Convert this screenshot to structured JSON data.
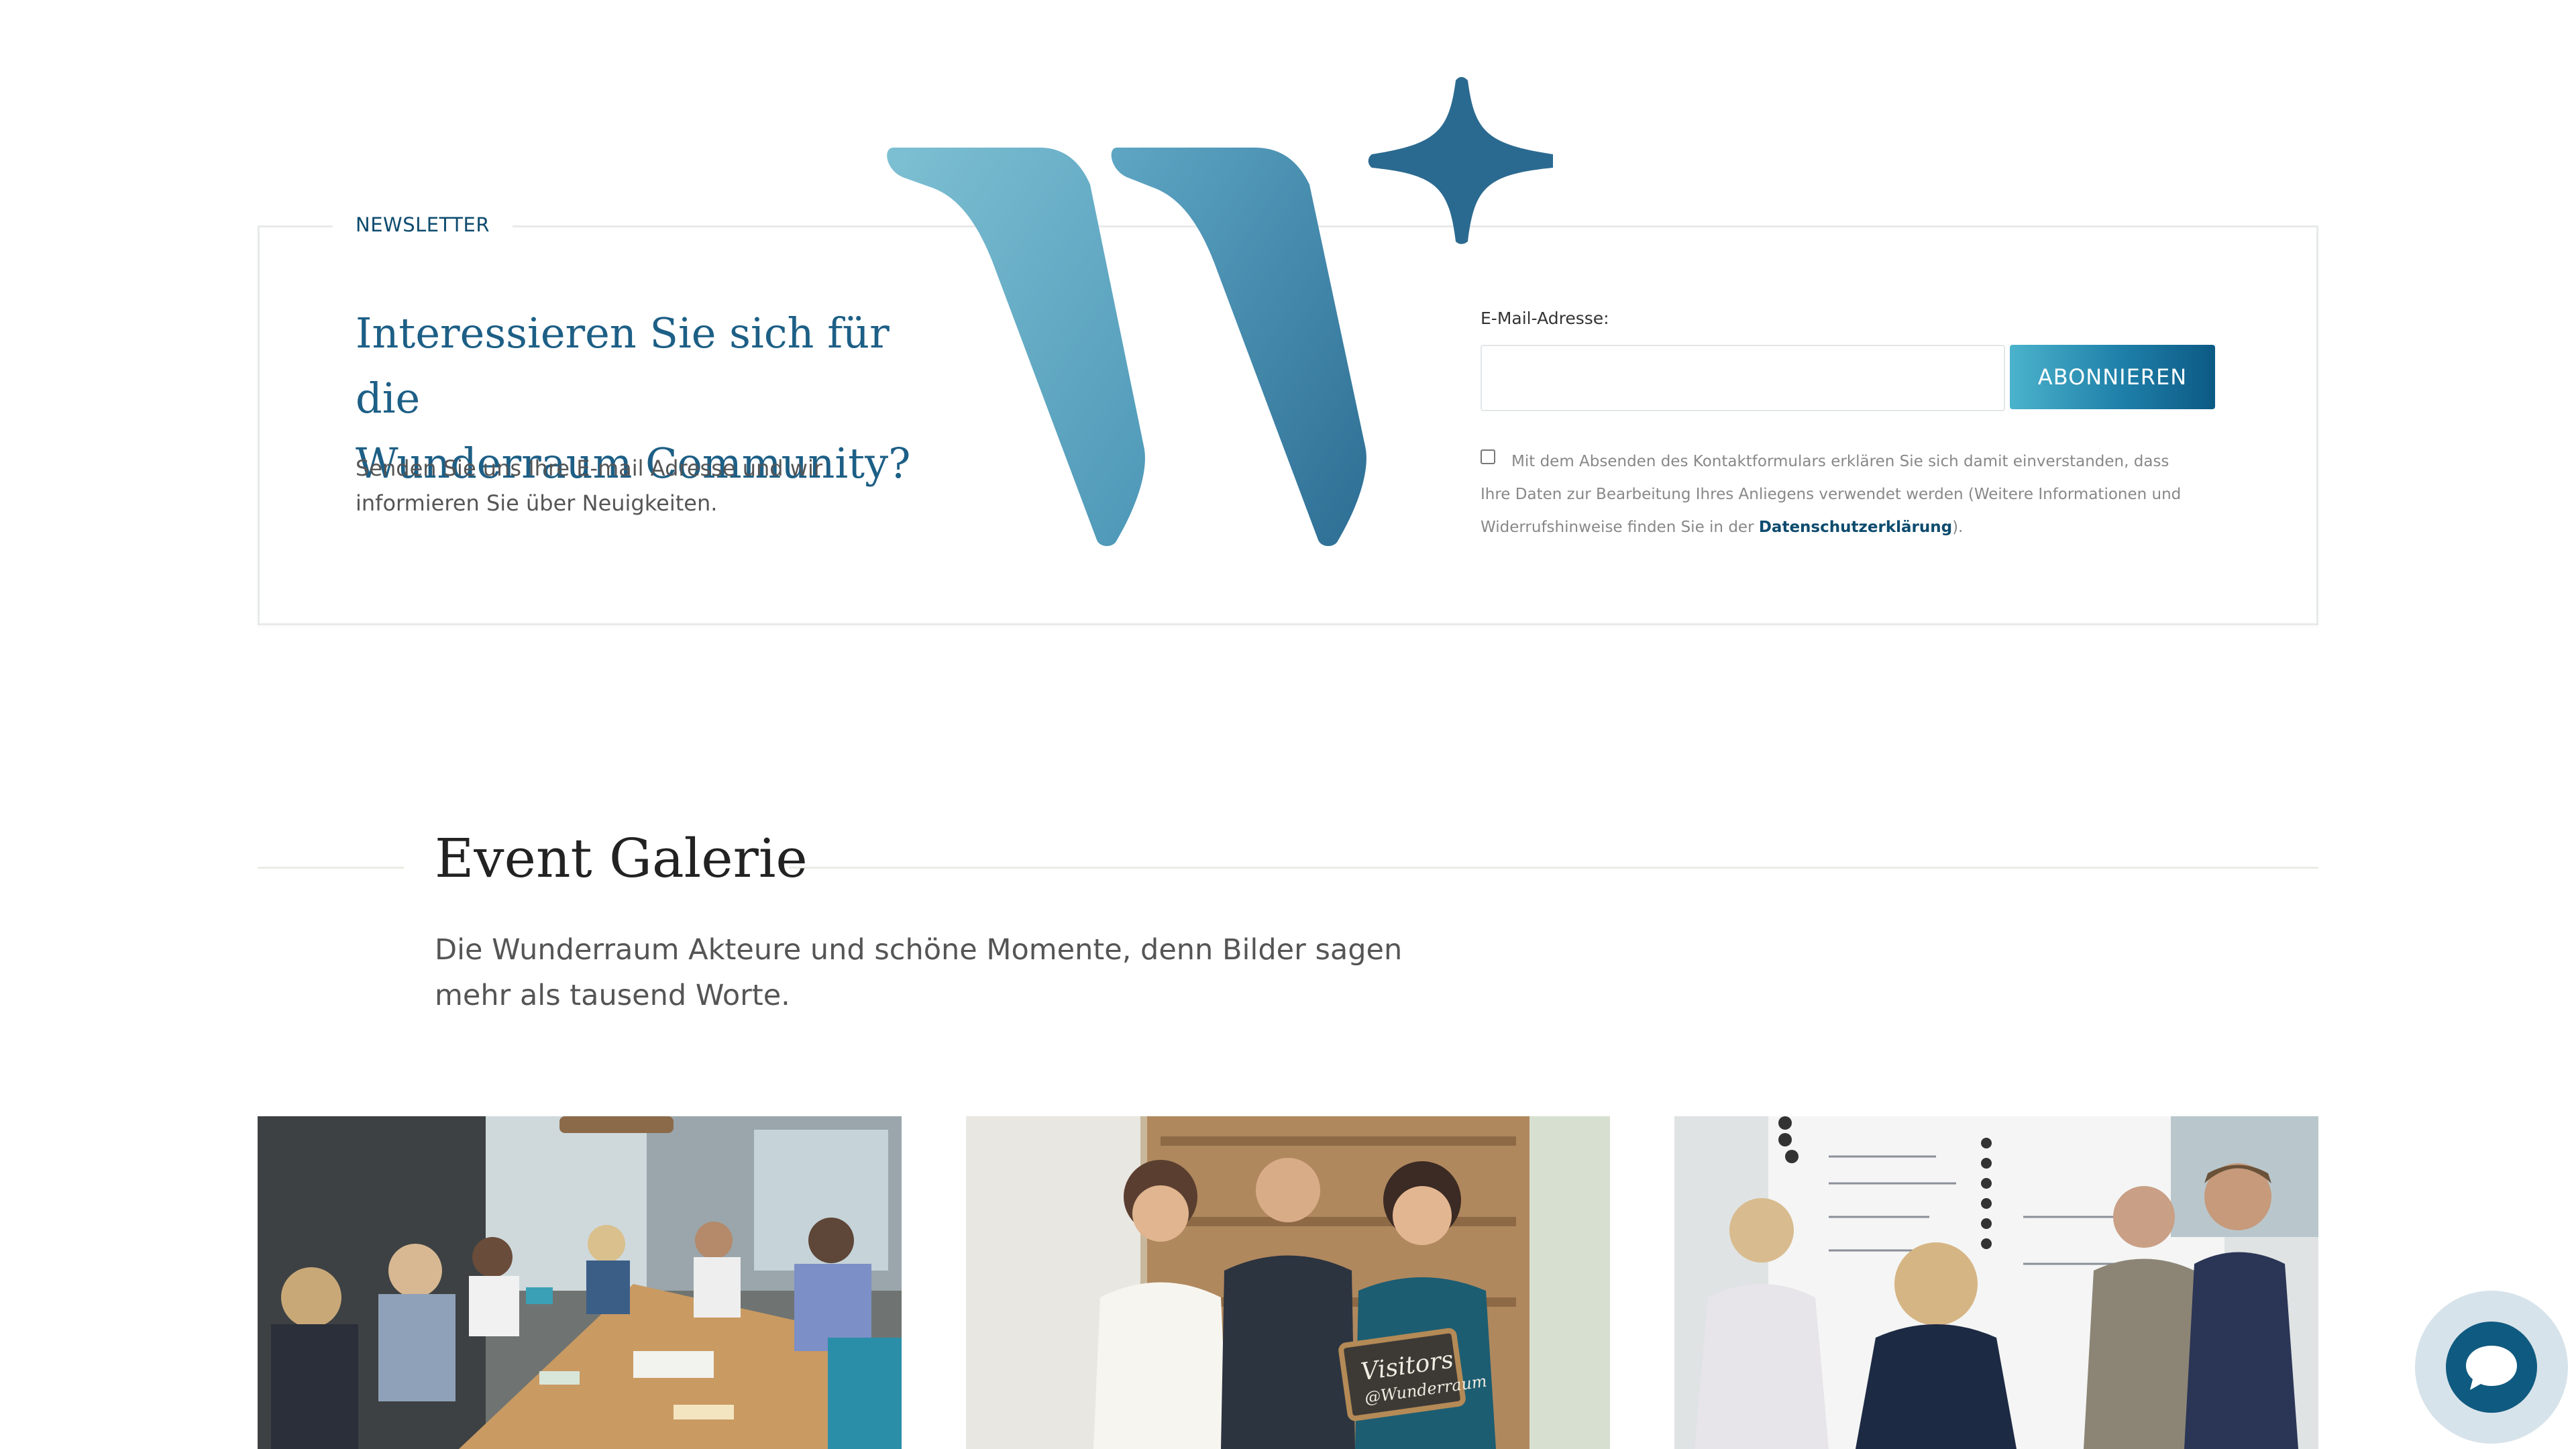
{
  "newsletter": {
    "legend": "NEWSLETTER",
    "heading_line1": "Interessieren Sie sich für die",
    "heading_line2": "Wunderraum Community?",
    "text": "Senden Sie uns Ihre E-mail Adresse und wir informieren Sie über Neuigkeiten.",
    "email_label": "E-Mail-Adresse:",
    "email_value": "",
    "email_placeholder": "",
    "subscribe_label": "ABONNIEREN",
    "consent_text": "Mit dem Absenden des Kontaktformulars erklären Sie sich damit einverstanden, dass Ihre Daten zur Bearbeitung Ihres Anliegens verwendet werden (Weitere Informationen und Widerrufshinweise finden Sie in der ",
    "consent_link": "Datenschutzerklärung",
    "consent_end": ").",
    "consent_checked": false
  },
  "gallery": {
    "title": "Event Galerie",
    "subtitle": "Die Wunderraum Akteure und schöne Momente, denn Bilder sagen mehr als tausend Worte.",
    "photos": [
      {
        "icon": "meeting-table-photo"
      },
      {
        "icon": "three-people-chalkboard-photo",
        "sign_text_1": "Visitors",
        "sign_text_2": "@Wunderraum"
      },
      {
        "icon": "whiteboard-discussion-photo"
      }
    ]
  },
  "chat": {
    "icon": "chat-bubble-icon"
  },
  "colors": {
    "brand_dark": "#0d4b6e",
    "heading_blue": "#1d5f86",
    "button_gradient_start": "#4bb3cc",
    "button_gradient_end": "#0c5a85"
  }
}
